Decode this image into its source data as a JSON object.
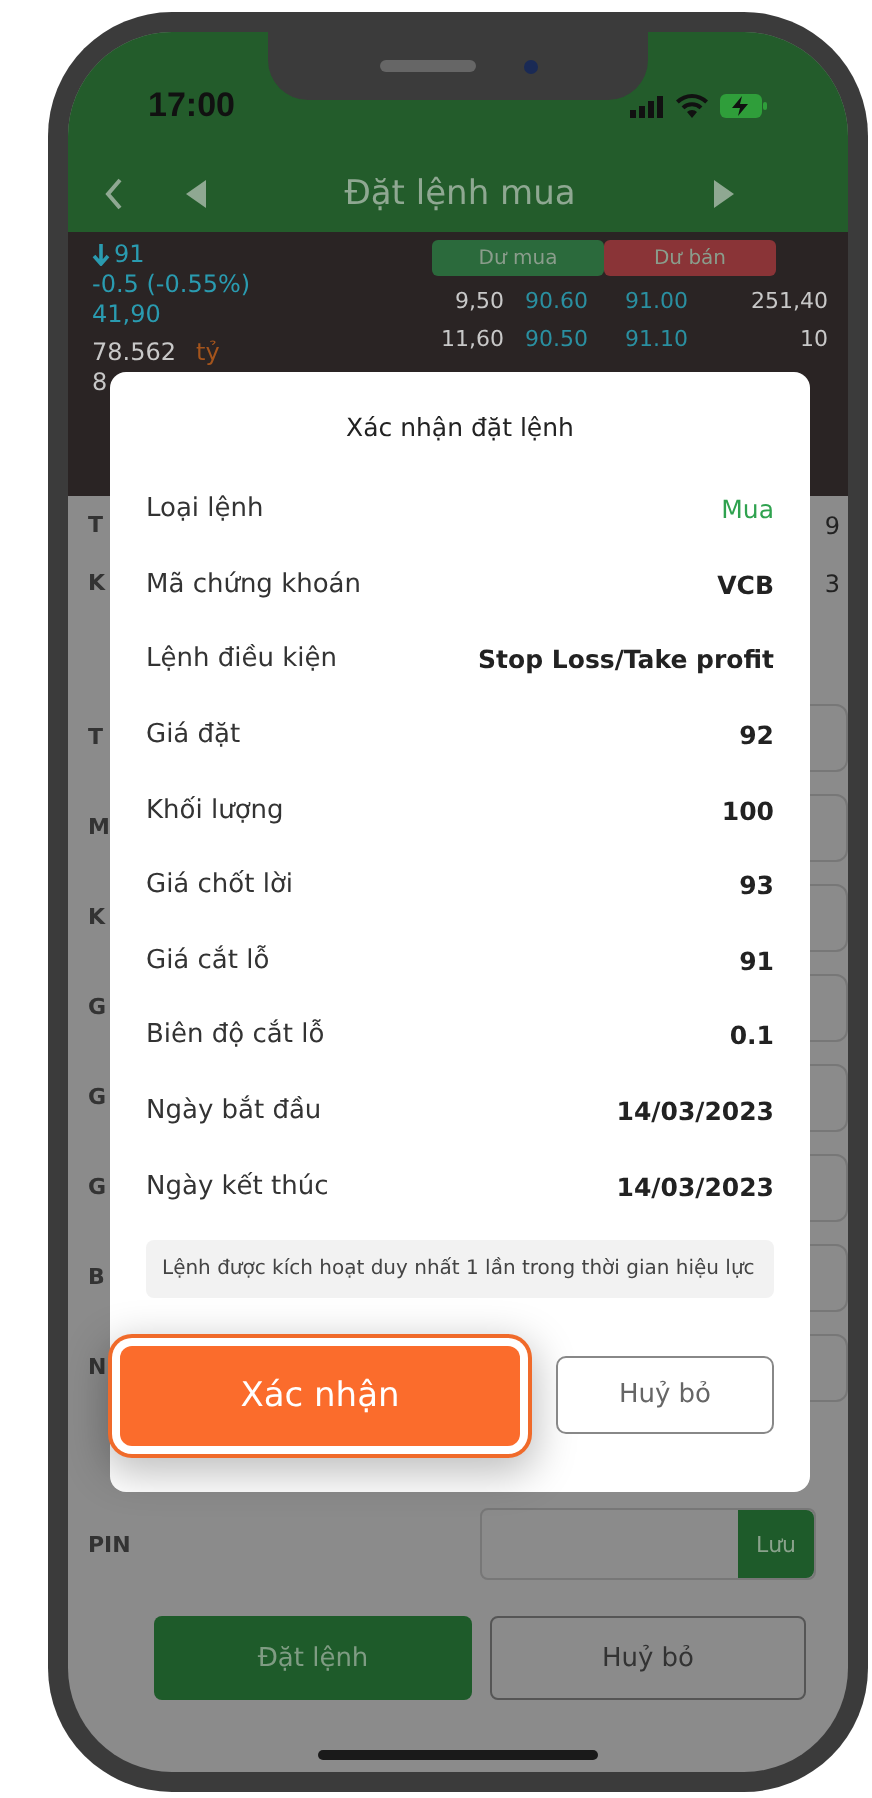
{
  "status_bar": {
    "time": "17:00"
  },
  "header": {
    "title": "Đặt lệnh mua"
  },
  "quote": {
    "price": "91",
    "change": "-0.5 (-0.55%)",
    "line_3": "41,90",
    "volume": "78.562",
    "unit": "tỷ",
    "line_5": "8"
  },
  "depth": {
    "tabs": [
      {
        "label": "Dư mua",
        "color": "#2b6a3c"
      },
      {
        "label": "Dư bán",
        "color": "#8a3437"
      }
    ],
    "rows": [
      [
        "9,50",
        "90.60",
        "91.00",
        "251,40"
      ],
      [
        "11,60",
        "90.50",
        "91.10",
        "10"
      ]
    ]
  },
  "form": {
    "rows": [
      {
        "kind": "compact",
        "label": "T",
        "value": "9"
      },
      {
        "kind": "compact",
        "label": "K",
        "value": "3"
      },
      {
        "kind": "field",
        "label": "T"
      },
      {
        "kind": "field",
        "label": "M"
      },
      {
        "kind": "field",
        "label": "K"
      },
      {
        "kind": "field",
        "label": "G"
      },
      {
        "kind": "field",
        "label": "G"
      },
      {
        "kind": "field",
        "label": "G"
      },
      {
        "kind": "field",
        "label": "B"
      },
      {
        "kind": "field",
        "label": "N"
      }
    ],
    "pin_label": "PIN",
    "save": "Lưu",
    "submit": "Đặt lệnh",
    "cancel": "Huỷ bỏ"
  },
  "dialog": {
    "title": "Xác nhận đặt lệnh",
    "rows": [
      {
        "kind": "buy",
        "label": "Loại lệnh",
        "value": "Mua"
      },
      {
        "kind": "text",
        "label": "Mã chứng khoán",
        "value": "VCB"
      },
      {
        "kind": "text",
        "label": "Lệnh điều kiện",
        "value": "Stop Loss/Take profit"
      },
      {
        "kind": "text",
        "label": "Giá đặt",
        "value": "92"
      },
      {
        "kind": "text",
        "label": "Khối lượng",
        "value": "100"
      },
      {
        "kind": "text",
        "label": "Giá chốt lời",
        "value": "93"
      },
      {
        "kind": "text",
        "label": "Giá cắt lỗ",
        "value": "91"
      },
      {
        "kind": "text",
        "label": "Biên độ cắt lỗ",
        "value": "0.1"
      },
      {
        "kind": "text",
        "label": "Ngày bắt đầu",
        "value": "14/03/2023"
      },
      {
        "kind": "text",
        "label": "Ngày kết thúc",
        "value": "14/03/2023"
      }
    ],
    "note": "Lệnh được kích hoạt duy nhất 1 lần trong thời gian hiệu lực",
    "confirm": "Xác nhận",
    "cancel": "Huỷ bỏ"
  }
}
